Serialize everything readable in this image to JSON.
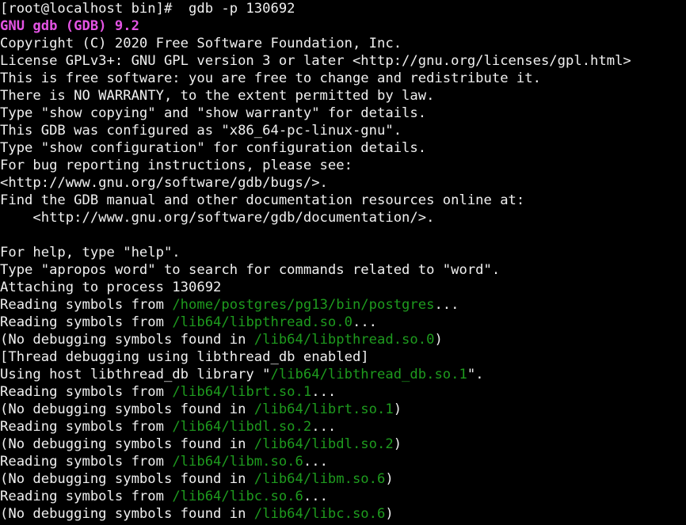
{
  "terminal": {
    "colors": {
      "background": "#000000",
      "text": "#f0f0f0",
      "path": "#1e9b1e",
      "banner": "#e454e4"
    },
    "lines": [
      [
        {
          "t": "[root@localhost bin]#  gdb -p 130692",
          "s": "plain"
        }
      ],
      [
        {
          "t": "GNU gdb (GDB) 9.2",
          "s": "banner"
        }
      ],
      [
        {
          "t": "Copyright (C) 2020 Free Software Foundation, Inc.",
          "s": "plain"
        }
      ],
      [
        {
          "t": "License GPLv3+: GNU GPL version 3 or later <http://gnu.org/licenses/gpl.html>",
          "s": "plain"
        }
      ],
      [
        {
          "t": "This is free software: you are free to change and redistribute it.",
          "s": "plain"
        }
      ],
      [
        {
          "t": "There is NO WARRANTY, to the extent permitted by law.",
          "s": "plain"
        }
      ],
      [
        {
          "t": "Type \"show copying\" and \"show warranty\" for details.",
          "s": "plain"
        }
      ],
      [
        {
          "t": "This GDB was configured as \"x86_64-pc-linux-gnu\".",
          "s": "plain"
        }
      ],
      [
        {
          "t": "Type \"show configuration\" for configuration details.",
          "s": "plain"
        }
      ],
      [
        {
          "t": "For bug reporting instructions, please see:",
          "s": "plain"
        }
      ],
      [
        {
          "t": "<http://www.gnu.org/software/gdb/bugs/>.",
          "s": "plain"
        }
      ],
      [
        {
          "t": "Find the GDB manual and other documentation resources online at:",
          "s": "plain"
        }
      ],
      [
        {
          "t": "    <http://www.gnu.org/software/gdb/documentation/>.",
          "s": "plain"
        }
      ],
      [
        {
          "t": "",
          "s": "plain"
        }
      ],
      [
        {
          "t": "For help, type \"help\".",
          "s": "plain"
        }
      ],
      [
        {
          "t": "Type \"apropos word\" to search for commands related to \"word\".",
          "s": "plain"
        }
      ],
      [
        {
          "t": "Attaching to process 130692",
          "s": "plain"
        }
      ],
      [
        {
          "t": "Reading symbols from ",
          "s": "plain"
        },
        {
          "t": "/home/postgres/pg13/bin/postgres",
          "s": "path"
        },
        {
          "t": "...",
          "s": "plain"
        }
      ],
      [
        {
          "t": "Reading symbols from ",
          "s": "plain"
        },
        {
          "t": "/lib64/libpthread.so.0",
          "s": "path"
        },
        {
          "t": "...",
          "s": "plain"
        }
      ],
      [
        {
          "t": "(No debugging symbols found in ",
          "s": "plain"
        },
        {
          "t": "/lib64/libpthread.so.0",
          "s": "path"
        },
        {
          "t": ")",
          "s": "plain"
        }
      ],
      [
        {
          "t": "[Thread debugging using libthread_db enabled]",
          "s": "plain"
        }
      ],
      [
        {
          "t": "Using host libthread_db library \"",
          "s": "plain"
        },
        {
          "t": "/lib64/libthread_db.so.1",
          "s": "path"
        },
        {
          "t": "\".",
          "s": "plain"
        }
      ],
      [
        {
          "t": "Reading symbols from ",
          "s": "plain"
        },
        {
          "t": "/lib64/librt.so.1",
          "s": "path"
        },
        {
          "t": "...",
          "s": "plain"
        }
      ],
      [
        {
          "t": "(No debugging symbols found in ",
          "s": "plain"
        },
        {
          "t": "/lib64/librt.so.1",
          "s": "path"
        },
        {
          "t": ")",
          "s": "plain"
        }
      ],
      [
        {
          "t": "Reading symbols from ",
          "s": "plain"
        },
        {
          "t": "/lib64/libdl.so.2",
          "s": "path"
        },
        {
          "t": "...",
          "s": "plain"
        }
      ],
      [
        {
          "t": "(No debugging symbols found in ",
          "s": "plain"
        },
        {
          "t": "/lib64/libdl.so.2",
          "s": "path"
        },
        {
          "t": ")",
          "s": "plain"
        }
      ],
      [
        {
          "t": "Reading symbols from ",
          "s": "plain"
        },
        {
          "t": "/lib64/libm.so.6",
          "s": "path"
        },
        {
          "t": "...",
          "s": "plain"
        }
      ],
      [
        {
          "t": "(No debugging symbols found in ",
          "s": "plain"
        },
        {
          "t": "/lib64/libm.so.6",
          "s": "path"
        },
        {
          "t": ")",
          "s": "plain"
        }
      ],
      [
        {
          "t": "Reading symbols from ",
          "s": "plain"
        },
        {
          "t": "/lib64/libc.so.6",
          "s": "path"
        },
        {
          "t": "...",
          "s": "plain"
        }
      ],
      [
        {
          "t": "(No debugging symbols found in ",
          "s": "plain"
        },
        {
          "t": "/lib64/libc.so.6",
          "s": "path"
        },
        {
          "t": ")",
          "s": "plain"
        }
      ]
    ]
  }
}
